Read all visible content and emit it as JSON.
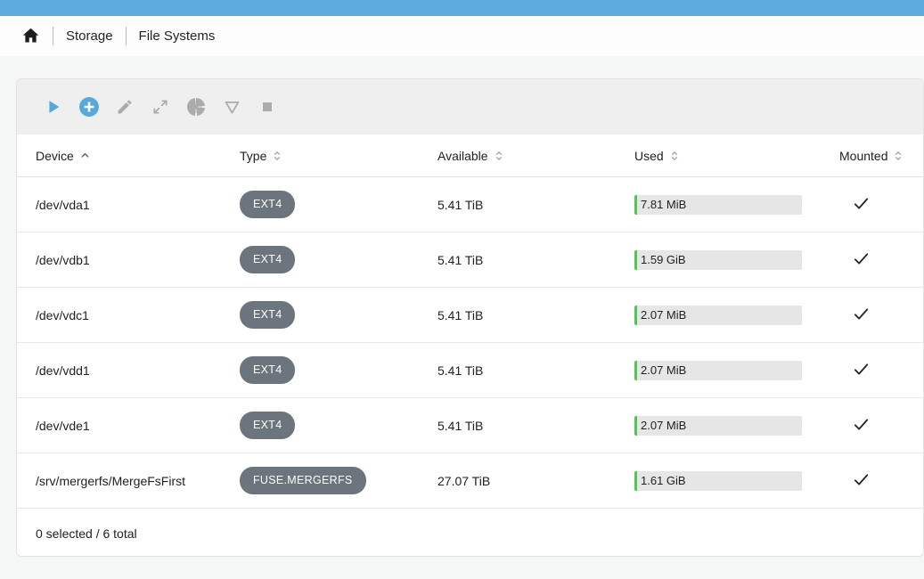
{
  "breadcrumb": {
    "items": [
      "Storage",
      "File Systems"
    ]
  },
  "toolbar": {
    "buttons": [
      {
        "icon": "play-icon",
        "enabled": true
      },
      {
        "icon": "add-icon",
        "enabled": true
      },
      {
        "icon": "edit-icon",
        "enabled": false
      },
      {
        "icon": "resize-icon",
        "enabled": false
      },
      {
        "icon": "quota-pie-icon",
        "enabled": false
      },
      {
        "icon": "unmount-icon",
        "enabled": false
      },
      {
        "icon": "delete-icon",
        "enabled": false
      }
    ]
  },
  "table": {
    "columns": [
      {
        "label": "Device",
        "sort": "asc"
      },
      {
        "label": "Type",
        "sort": "none"
      },
      {
        "label": "Available",
        "sort": "none"
      },
      {
        "label": "Used",
        "sort": "none"
      },
      {
        "label": "Mounted",
        "sort": "none"
      }
    ],
    "rows": [
      {
        "device": "/dev/vda1",
        "type": "EXT4",
        "available": "5.41 TiB",
        "used": "7.81 MiB",
        "mounted": true
      },
      {
        "device": "/dev/vdb1",
        "type": "EXT4",
        "available": "5.41 TiB",
        "used": "1.59 GiB",
        "mounted": true
      },
      {
        "device": "/dev/vdc1",
        "type": "EXT4",
        "available": "5.41 TiB",
        "used": "2.07 MiB",
        "mounted": true
      },
      {
        "device": "/dev/vdd1",
        "type": "EXT4",
        "available": "5.41 TiB",
        "used": "2.07 MiB",
        "mounted": true
      },
      {
        "device": "/dev/vde1",
        "type": "EXT4",
        "available": "5.41 TiB",
        "used": "2.07 MiB",
        "mounted": true
      },
      {
        "device": "/srv/mergerfs/MergeFsFirst",
        "type": "FUSE.MERGERFS",
        "available": "27.07 TiB",
        "used": "1.61 GiB",
        "mounted": true
      }
    ],
    "footer": "0 selected / 6 total"
  },
  "colors": {
    "topbar": "#5dacdf",
    "accent_blue": "#57a9d9",
    "badge_gray": "#6c757d",
    "progress_green": "#52c552",
    "progress_bg": "#e6e6e6",
    "disabled_icon": "#ababab"
  }
}
